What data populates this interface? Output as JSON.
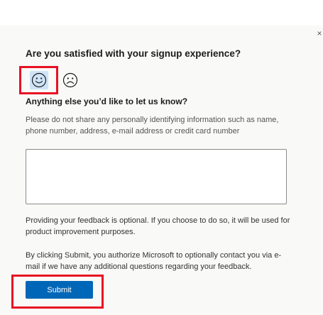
{
  "dialog": {
    "close_glyph": "×",
    "question": "Are you satisfied with your signup experience?",
    "ratings": [
      {
        "icon": "smiley-face-icon",
        "selected": true
      },
      {
        "icon": "frown-face-icon",
        "selected": false
      }
    ],
    "subheading": "Anything else you’d like to let us know?",
    "privacy_note": "Please do not share any personally identifying information such as name, phone number, address, e-mail address or credit card number",
    "feedback_value": "",
    "optional_note": "Providing your feedback is optional. If you choose to do so, it will be used for product improvement purposes.",
    "consent_note": "By clicking Submit, you authorize Microsoft to optionally contact you via e-mail if we have any additional questions regarding your feedback.",
    "submit_label": "Submit"
  },
  "colors": {
    "accent": "#0067b8",
    "highlight": "#e81123",
    "selected_face_bg": "#cfe3f7",
    "panel_bg": "#f9f9f8"
  }
}
